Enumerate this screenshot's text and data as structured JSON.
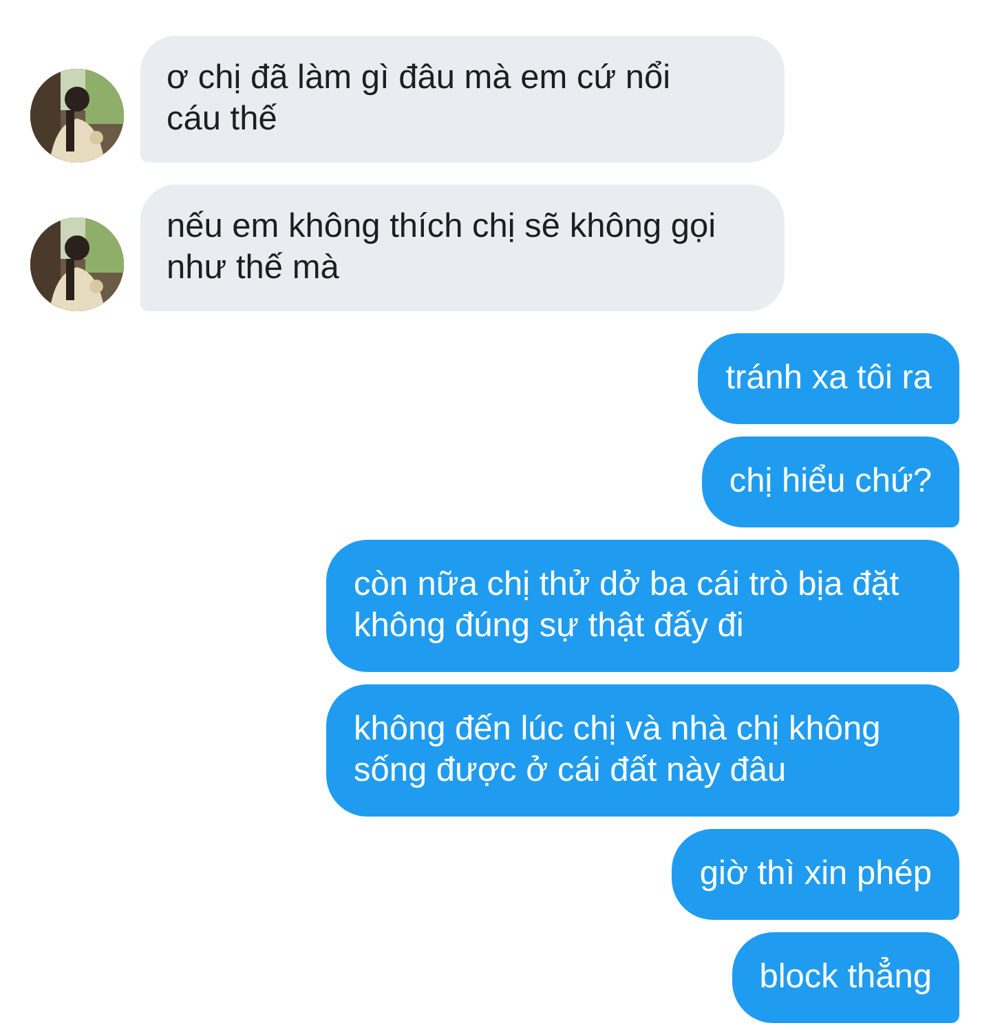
{
  "messages": [
    {
      "kind": "received",
      "text": "ơ chị đã làm gì đâu mà em cứ nổi cáu thế",
      "avatar": true
    },
    {
      "kind": "received",
      "text": "nếu em không thích chị sẽ không gọi như thế mà",
      "avatar": true
    },
    {
      "kind": "sent",
      "text": "tránh xa tôi ra"
    },
    {
      "kind": "sent",
      "text": "chị hiểu chứ?"
    },
    {
      "kind": "sent",
      "text": "còn nữa chị thử dở ba cái trò bịa đặt không đúng sự thật đấy đi"
    },
    {
      "kind": "sent",
      "text": "không đến lúc chị và nhà chị không sống được ở cái đất này đâu"
    },
    {
      "kind": "sent",
      "text": "giờ thì xin phép"
    },
    {
      "kind": "sent",
      "text": "block thẳng"
    }
  ]
}
